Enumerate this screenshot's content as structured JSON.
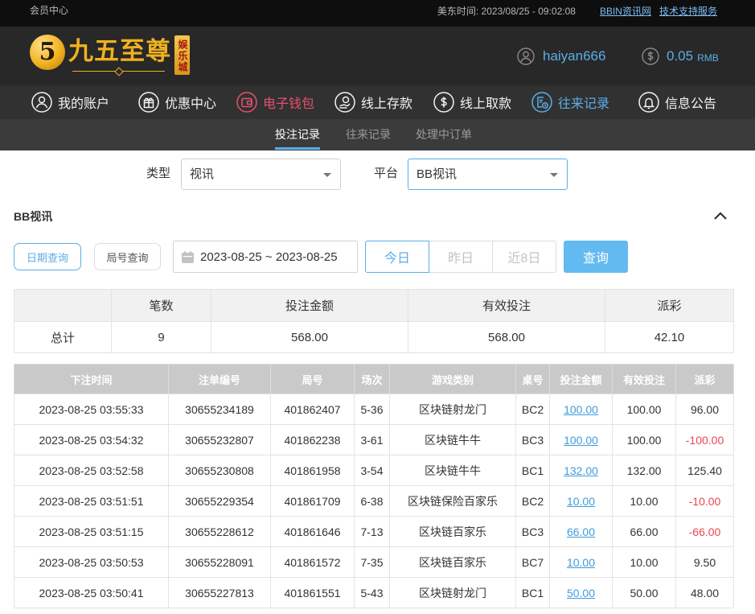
{
  "colors": {
    "accent": "#5aaee8",
    "wallet": "#e8506c",
    "negative": "#e8474c",
    "link": "#3d9cdb",
    "gold": "#f0b21e",
    "button": "#62baf0"
  },
  "topbar": {
    "member_center": "会员中心",
    "time": "美东时间: 2023/08/25 - 09:02:08",
    "links": [
      "BBIN资讯网",
      "技术支持服务"
    ]
  },
  "header": {
    "logo": {
      "numeral": "5",
      "name": "九五至尊",
      "badge": "娱乐城"
    },
    "user": {
      "icon": "user-avatar-icon",
      "username": "haiyan666"
    },
    "balance": {
      "icon": "dollar-icon",
      "amount": "0.05",
      "currency": "RMB"
    }
  },
  "nav": {
    "items": [
      {
        "label": "我的账户",
        "icon": "user-icon"
      },
      {
        "label": "优惠中心",
        "icon": "gift-icon"
      },
      {
        "label": "电子钱包",
        "icon": "wallet-icon",
        "highlight": true
      },
      {
        "label": "线上存款",
        "icon": "deposit-icon"
      },
      {
        "label": "线上取款",
        "icon": "withdraw-icon"
      },
      {
        "label": "往来记录",
        "icon": "records-icon",
        "active": true
      },
      {
        "label": "信息公告",
        "icon": "bell-icon"
      }
    ]
  },
  "subnav": {
    "tabs": [
      {
        "label": "投注记录",
        "active": true
      },
      {
        "label": "往来记录",
        "active": false
      },
      {
        "label": "处理中订单",
        "active": false
      }
    ]
  },
  "filters": {
    "type": {
      "label": "类型",
      "value": "视讯"
    },
    "platform": {
      "label": "平台",
      "value": "BB视讯",
      "focused": true
    }
  },
  "section": {
    "title": "BB视讯",
    "collapse_icon": "chevron-up-icon"
  },
  "query": {
    "modes": [
      {
        "label": "日期查询",
        "active": true
      },
      {
        "label": "局号查询",
        "active": false
      }
    ],
    "date_range": "2023-08-25 ~ 2023-08-25",
    "quick_ranges": [
      {
        "label": "今日",
        "active": true
      },
      {
        "label": "昨日",
        "active": false
      },
      {
        "label": "近8日",
        "active": false
      }
    ],
    "submit": "查询"
  },
  "summary": {
    "headers": {
      "count": "笔数",
      "bet": "投注金额",
      "valid": "有效投注",
      "payout": "派彩"
    },
    "total_label": "总计",
    "count": "9",
    "bet": "568.00",
    "valid": "568.00",
    "payout": "42.10"
  },
  "records": {
    "headers": [
      "下注时间",
      "注单编号",
      "局号",
      "场次",
      "游戏类别",
      "桌号",
      "投注金额",
      "有效投注",
      "派彩"
    ],
    "rows": [
      [
        "2023-08-25 03:55:33",
        "30655234189",
        "401862407",
        "5-36",
        "区块链射龙门",
        "BC2",
        "100.00",
        "100.00",
        "96.00"
      ],
      [
        "2023-08-25 03:54:32",
        "30655232807",
        "401862238",
        "3-61",
        "区块链牛牛",
        "BC3",
        "100.00",
        "100.00",
        "-100.00"
      ],
      [
        "2023-08-25 03:52:58",
        "30655230808",
        "401861958",
        "3-54",
        "区块链牛牛",
        "BC1",
        "132.00",
        "132.00",
        "125.40"
      ],
      [
        "2023-08-25 03:51:51",
        "30655229354",
        "401861709",
        "6-38",
        "区块链保险百家乐",
        "BC2",
        "10.00",
        "10.00",
        "-10.00"
      ],
      [
        "2023-08-25 03:51:15",
        "30655228612",
        "401861646",
        "7-13",
        "区块链百家乐",
        "BC3",
        "66.00",
        "66.00",
        "-66.00"
      ],
      [
        "2023-08-25 03:50:53",
        "30655228091",
        "401861572",
        "7-35",
        "区块链百家乐",
        "BC7",
        "10.00",
        "10.00",
        "9.50"
      ],
      [
        "2023-08-25 03:50:41",
        "30655227813",
        "401861551",
        "5-43",
        "区块链射龙门",
        "BC1",
        "50.00",
        "50.00",
        "48.00"
      ]
    ]
  }
}
